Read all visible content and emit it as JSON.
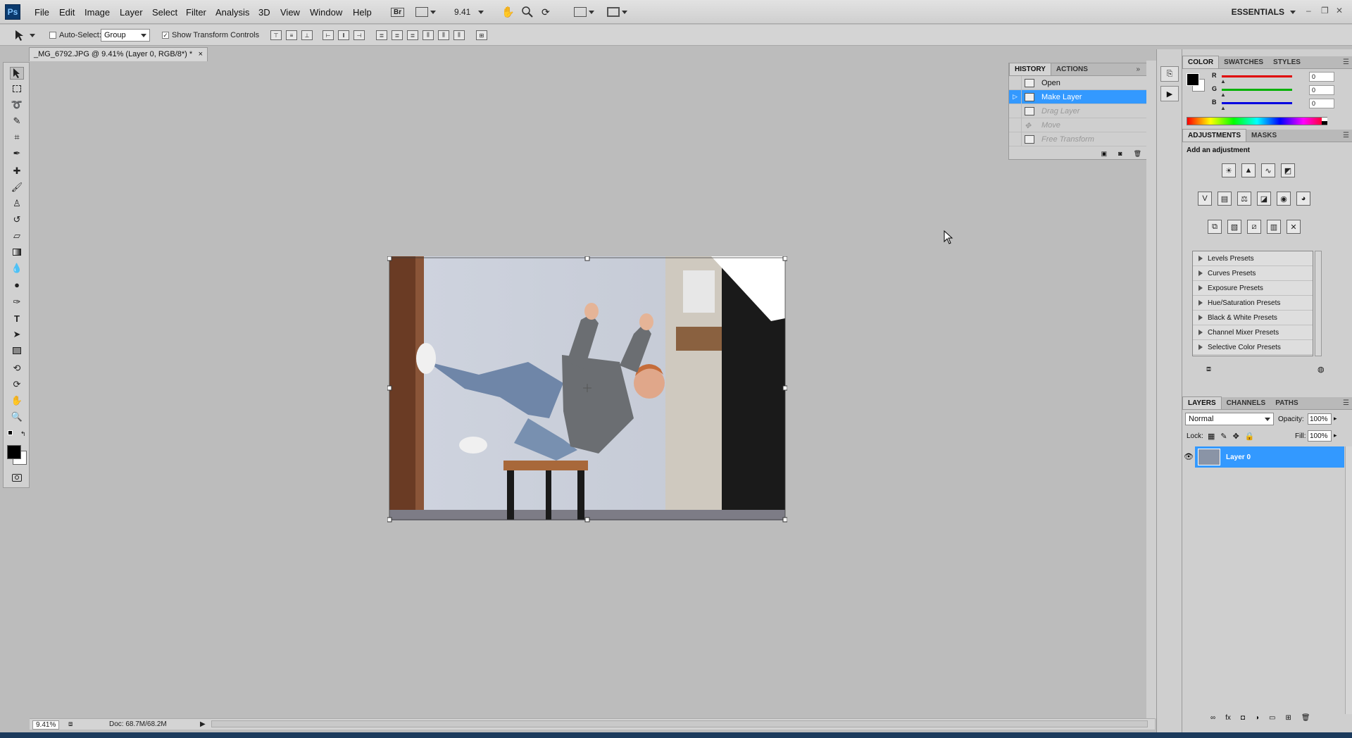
{
  "app": {
    "logo": "Ps"
  },
  "menu": [
    "File",
    "Edit",
    "Image",
    "Layer",
    "Select",
    "Filter",
    "Analysis",
    "3D",
    "View",
    "Window",
    "Help"
  ],
  "menubar_tools": {
    "bridge": "Br",
    "zoom_value": "9.41",
    "workspace": "ESSENTIALS"
  },
  "window_controls": {
    "minimize": "–",
    "restore": "❐",
    "close": "✕"
  },
  "options": {
    "auto_select_label": "Auto-Select:",
    "auto_select_checked": false,
    "auto_select_value": "Group",
    "show_transform_label": "Show Transform Controls",
    "show_transform_checked": true
  },
  "document": {
    "tab_title": "_MG_6792.JPG @ 9.41% (Layer 0, RGB/8*) *",
    "close": "×"
  },
  "status": {
    "zoom": "9.41%",
    "doc_info": "Doc: 68.7M/68.2M"
  },
  "history": {
    "tabs": [
      "HISTORY",
      "ACTIONS"
    ],
    "items": [
      {
        "label": "Open",
        "state": "normal"
      },
      {
        "label": "Make Layer",
        "state": "selected"
      },
      {
        "label": "Drag Layer",
        "state": "dim"
      },
      {
        "label": "Move",
        "state": "dim"
      },
      {
        "label": "Free Transform",
        "state": "dim"
      }
    ]
  },
  "color_panel": {
    "tabs": [
      "COLOR",
      "SWATCHES",
      "STYLES"
    ],
    "channels": [
      {
        "name": "R",
        "value": "0",
        "color": "#e00000"
      },
      {
        "name": "G",
        "value": "0",
        "color": "#00b000"
      },
      {
        "name": "B",
        "value": "0",
        "color": "#0000e0"
      }
    ]
  },
  "adjustments": {
    "tabs": [
      "ADJUSTMENTS",
      "MASKS"
    ],
    "heading": "Add an adjustment",
    "presets": [
      "Levels Presets",
      "Curves Presets",
      "Exposure Presets",
      "Hue/Saturation Presets",
      "Black & White Presets",
      "Channel Mixer Presets",
      "Selective Color Presets"
    ]
  },
  "layers": {
    "tabs": [
      "LAYERS",
      "CHANNELS",
      "PATHS"
    ],
    "blend_mode": "Normal",
    "opacity_label": "Opacity:",
    "opacity": "100%",
    "lock_label": "Lock:",
    "fill_label": "Fill:",
    "fill": "100%",
    "items": [
      {
        "name": "Layer 0",
        "selected": true
      }
    ]
  },
  "colors": {
    "accent": "#3399ff",
    "background": "#bcbcbc",
    "panel": "#cfcfcf"
  }
}
